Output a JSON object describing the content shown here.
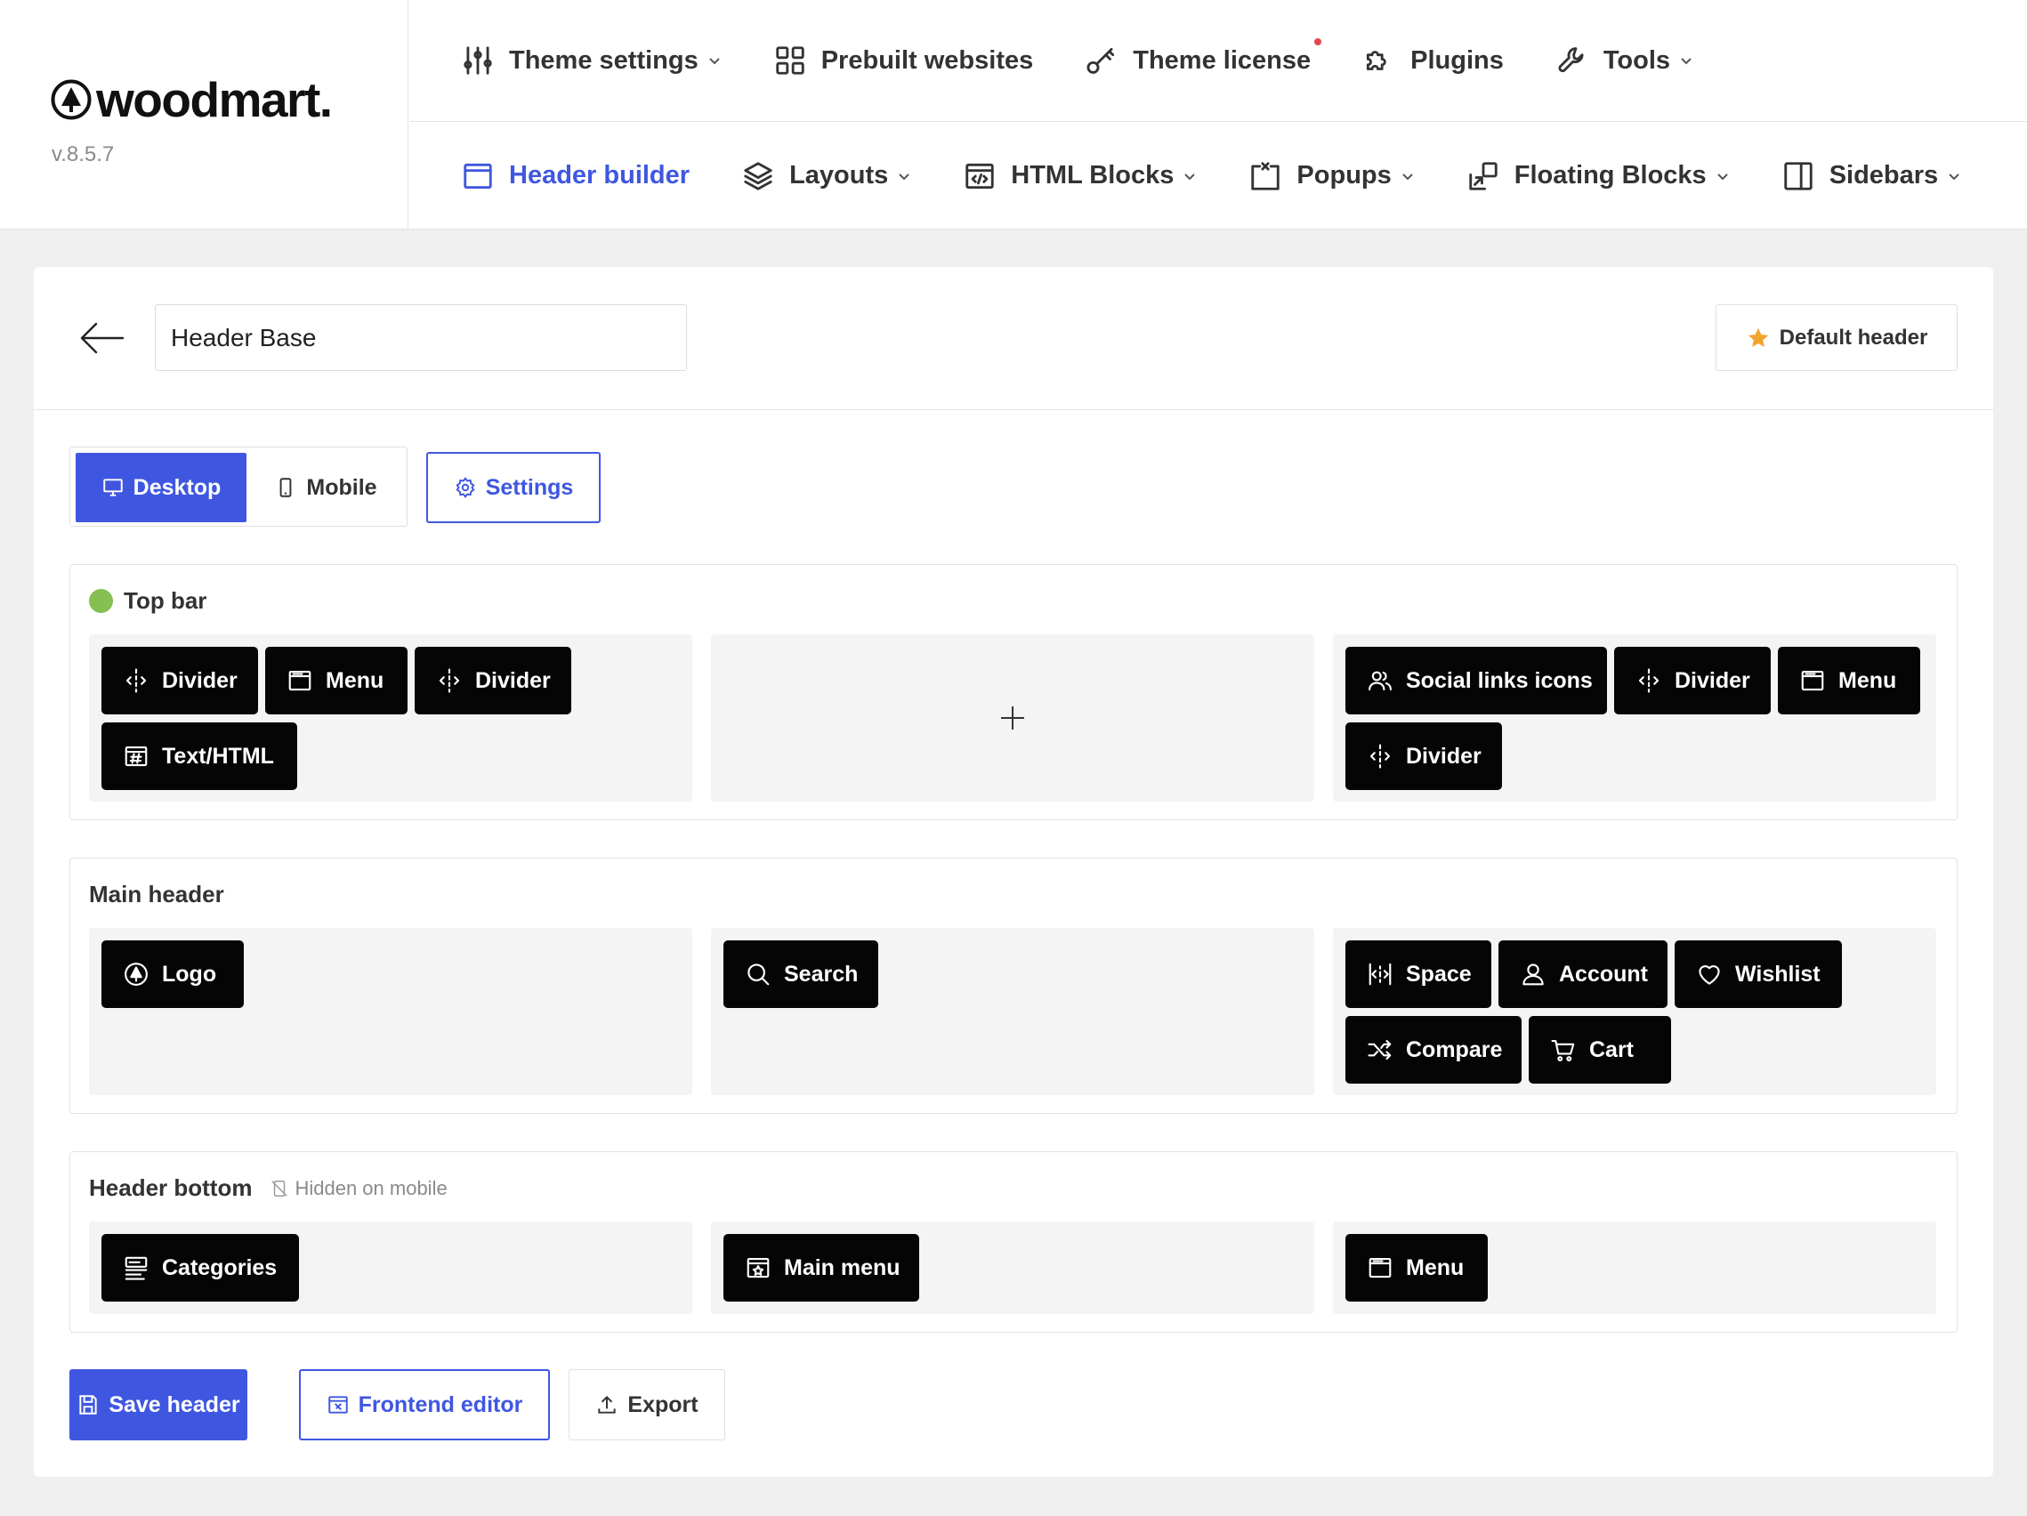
{
  "brand": {
    "name": "woodmart.",
    "version": "v.8.5.7"
  },
  "nav_top": [
    {
      "label": "Theme settings",
      "icon": "sliders-icon",
      "dropdown": true
    },
    {
      "label": "Prebuilt websites",
      "icon": "grid-icon",
      "dropdown": false
    },
    {
      "label": "Theme license",
      "icon": "key-icon",
      "dropdown": false,
      "notification": true
    },
    {
      "label": "Plugins",
      "icon": "puzzle-icon",
      "dropdown": false
    },
    {
      "label": "Tools",
      "icon": "wrench-icon",
      "dropdown": true
    }
  ],
  "nav_bottom": [
    {
      "label": "Header builder",
      "icon": "window-icon",
      "active": true
    },
    {
      "label": "Layouts",
      "icon": "layers-icon",
      "dropdown": true
    },
    {
      "label": "HTML Blocks",
      "icon": "code-icon",
      "dropdown": true
    },
    {
      "label": "Popups",
      "icon": "popup-icon",
      "dropdown": true
    },
    {
      "label": "Floating Blocks",
      "icon": "floating-icon",
      "dropdown": true
    },
    {
      "label": "Sidebars",
      "icon": "sidebar-icon",
      "dropdown": true
    }
  ],
  "editor": {
    "header_name": "Header Base",
    "default_label": "Default header",
    "desktop_label": "Desktop",
    "mobile_label": "Mobile",
    "settings_label": "Settings"
  },
  "rows": {
    "top_bar": {
      "title": "Top bar",
      "left": [
        "Divider",
        "Menu",
        "Divider",
        "Text/HTML"
      ],
      "right": [
        "Social links icons",
        "Divider",
        "Menu",
        "Divider"
      ]
    },
    "main_header": {
      "title": "Main header",
      "left": [
        "Logo"
      ],
      "center": [
        "Search"
      ],
      "right": [
        "Space",
        "Account",
        "Wishlist",
        "Compare",
        "Cart"
      ]
    },
    "header_bottom": {
      "title": "Header bottom",
      "note": "Hidden on mobile",
      "left": [
        "Categories"
      ],
      "center": [
        "Main menu"
      ],
      "right": [
        "Menu"
      ]
    }
  },
  "actions": {
    "save": "Save header",
    "frontend": "Frontend editor",
    "export": "Export"
  },
  "colors": {
    "accent": "#3f57e0",
    "status_green": "#86bf52",
    "element_bg": "#050505",
    "notification": "#e0484b"
  }
}
